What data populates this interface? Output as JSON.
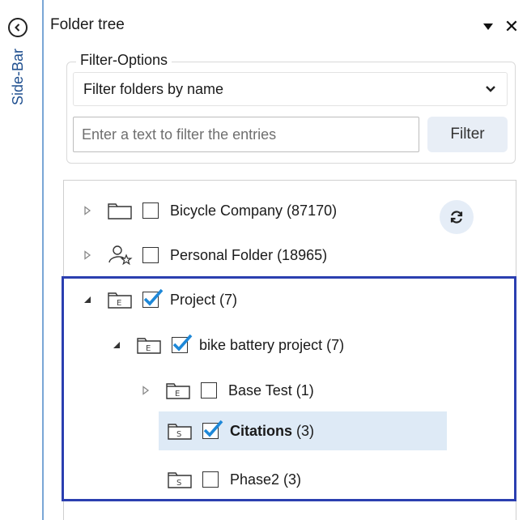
{
  "sidebar": {
    "label": "Side-Bar"
  },
  "panel": {
    "title": "Folder tree",
    "pin_icon": "triangle-down-icon",
    "close_glyph": "✕"
  },
  "filter": {
    "legend": "Filter-Options",
    "select_value": "Filter folders by name",
    "input_placeholder": "Enter a text to filter the entries",
    "input_value": "",
    "button_label": "Filter"
  },
  "tree": {
    "items": [
      {
        "name": "Bicycle Company",
        "count": "(87170)",
        "label": "Bicycle Company (87170)",
        "icon": "folder-icon",
        "expanded": false,
        "checked": false,
        "selected": false,
        "level": 0
      },
      {
        "name": "Personal Folder",
        "count": "(18965)",
        "label": "Personal Folder (18965)",
        "icon": "user-star-icon",
        "expanded": false,
        "checked": false,
        "selected": false,
        "level": 0
      },
      {
        "name": "Project",
        "count": "(7)",
        "label": "Project (7)",
        "icon": "folder-e-icon",
        "expanded": true,
        "checked": true,
        "selected": false,
        "level": 0
      },
      {
        "name": "bike battery project",
        "count": "(7)",
        "label": "bike battery project (7)",
        "icon": "folder-e-icon",
        "expanded": true,
        "checked": true,
        "selected": false,
        "level": 1
      },
      {
        "name": "Base Test",
        "count": "(1)",
        "label": "Base Test (1)",
        "icon": "folder-e-icon",
        "expanded": false,
        "checked": false,
        "selected": false,
        "level": 2
      },
      {
        "name": "Citations",
        "count": "(3)",
        "label": "Citations (3)",
        "icon": "folder-s-icon",
        "expanded": null,
        "checked": true,
        "selected": true,
        "level": 2
      },
      {
        "name": "Phase2",
        "count": "(3)",
        "label": "Phase2 (3)",
        "icon": "folder-s-icon",
        "expanded": null,
        "checked": false,
        "selected": false,
        "level": 2
      }
    ]
  },
  "colors": {
    "accent": "#2b3fb0",
    "check": "#1e88d8",
    "selection": "#deeaf6",
    "refresh_bg": "#e5edf7"
  }
}
